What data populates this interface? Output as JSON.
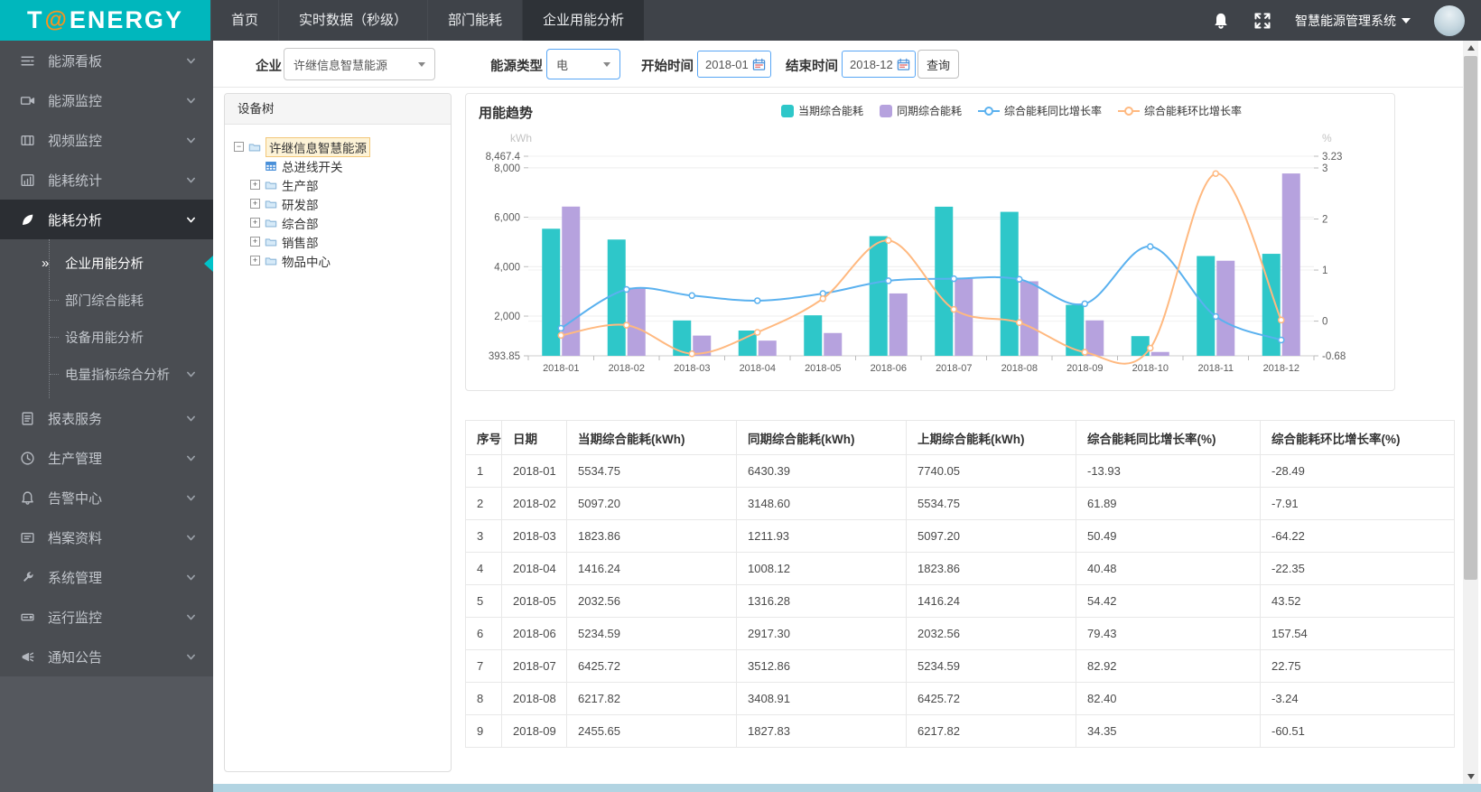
{
  "colors": {
    "brand_teal": "#00b7bd",
    "topbar_bg": "#3f4349",
    "sidebar_bg": "#4a4d52",
    "active_marker": "#00c2c9",
    "bar_current": "#2ec7c9",
    "bar_same_period": "#b6a2de",
    "line_yoy": "#5ab1ef",
    "line_mom": "#ffb980",
    "tree_highlight": "#fdf3d7"
  },
  "logo": {
    "t": "T",
    "at": "@",
    "rest": "ENERGY"
  },
  "topbar": {
    "nav": [
      {
        "label": "首页",
        "active": false
      },
      {
        "label": "实时数据（秒级）",
        "active": false
      },
      {
        "label": "部门能耗",
        "active": false
      },
      {
        "label": "企业用能分析",
        "active": true
      }
    ],
    "system_menu": "智慧能源管理系统"
  },
  "sidebar": {
    "items": [
      {
        "icon": "dashboard-icon",
        "label": "能源看板",
        "chevron": true
      },
      {
        "icon": "camera-icon",
        "label": "能源监控",
        "chevron": true
      },
      {
        "icon": "film-icon",
        "label": "视频监控",
        "chevron": true
      },
      {
        "icon": "stats-icon",
        "label": "能耗统计",
        "chevron": true
      },
      {
        "icon": "leaf-icon",
        "label": "能耗分析",
        "chevron": true,
        "active": true,
        "children": [
          {
            "label": "企业用能分析",
            "active": true
          },
          {
            "label": "部门综合能耗"
          },
          {
            "label": "设备用能分析"
          },
          {
            "label": "电量指标综合分析",
            "chevron": true
          }
        ]
      },
      {
        "icon": "report-icon",
        "label": "报表服务",
        "chevron": true
      },
      {
        "icon": "clock-icon",
        "label": "生产管理",
        "chevron": true
      },
      {
        "icon": "bell-icon",
        "label": "告警中心",
        "chevron": true
      },
      {
        "icon": "archive-icon",
        "label": "档案资料",
        "chevron": true
      },
      {
        "icon": "wrench-icon",
        "label": "系统管理",
        "chevron": true
      },
      {
        "icon": "drive-icon",
        "label": "运行监控",
        "chevron": true
      },
      {
        "icon": "megaphone-icon",
        "label": "通知公告",
        "chevron": true
      }
    ]
  },
  "filters": {
    "company_label": "企业",
    "company_value": "许继信息智慧能源",
    "energy_label": "能源类型",
    "energy_value": "电",
    "start_label": "开始时间",
    "start_value": "2018-01",
    "end_label": "结束时间",
    "end_value": "2018-12",
    "query_label": "查询"
  },
  "tree": {
    "title": "设备树",
    "root": {
      "label": "许继信息智慧能源",
      "selected": true
    },
    "children": [
      {
        "label": "总进线开关",
        "icon": "grid-icon",
        "expandable": false
      },
      {
        "label": "生产部",
        "icon": "folder-icon",
        "expandable": true
      },
      {
        "label": "研发部",
        "icon": "folder-icon",
        "expandable": true
      },
      {
        "label": "综合部",
        "icon": "folder-icon",
        "expandable": true
      },
      {
        "label": "销售部",
        "icon": "folder-icon",
        "expandable": true
      },
      {
        "label": "物品中心",
        "icon": "folder-icon",
        "expandable": true
      }
    ]
  },
  "chart": {
    "title": "用能趋势",
    "legend": [
      {
        "label": "当期综合能耗",
        "marker": "rect",
        "color": "#2ec7c9"
      },
      {
        "label": "同期综合能耗",
        "marker": "rect",
        "color": "#b6a2de"
      },
      {
        "label": "综合能耗同比增长率",
        "marker": "line",
        "color": "#5ab1ef"
      },
      {
        "label": "综合能耗环比增长率",
        "marker": "line",
        "color": "#ffb980"
      }
    ]
  },
  "chart_data": {
    "type": "bar",
    "title": "用能趋势",
    "categories": [
      "2018-01",
      "2018-02",
      "2018-03",
      "2018-04",
      "2018-05",
      "2018-06",
      "2018-07",
      "2018-08",
      "2018-09",
      "2018-10",
      "2018-11",
      "2018-12"
    ],
    "series": [
      {
        "name": "当期综合能耗",
        "type": "bar",
        "axis": "left",
        "color": "#2ec7c9",
        "values": [
          5534.75,
          5097.2,
          1823.86,
          1416.24,
          2032.56,
          5234.59,
          6425.72,
          6217.82,
          2455.65,
          1190,
          4430,
          4520
        ]
      },
      {
        "name": "同期综合能耗",
        "type": "bar",
        "axis": "left",
        "color": "#b6a2de",
        "values": [
          6430.39,
          3148.6,
          1211.93,
          1008.12,
          1316.28,
          2917.3,
          3512.86,
          3408.91,
          1827.83,
          550,
          4240,
          7770
        ]
      },
      {
        "name": "综合能耗同比增长率",
        "type": "line",
        "axis": "right",
        "color": "#5ab1ef",
        "values": [
          -0.14,
          0.62,
          0.5,
          0.4,
          0.54,
          0.79,
          0.83,
          0.82,
          0.34,
          1.46,
          0.09,
          -0.37
        ]
      },
      {
        "name": "综合能耗环比增长率",
        "type": "line",
        "axis": "right",
        "color": "#ffb980",
        "values": [
          -0.28,
          -0.08,
          -0.64,
          -0.22,
          0.44,
          1.58,
          0.23,
          -0.03,
          -0.61,
          -0.53,
          2.89,
          0.02
        ]
      }
    ],
    "y_left": {
      "name": "kWh",
      "min": 393.85,
      "max": 8467.4,
      "ticks": [
        393.85,
        2000,
        4000,
        6000,
        8000,
        8467.4
      ],
      "tick_labels": [
        "393.85",
        "2,000",
        "4,000",
        "6,000",
        "8,000",
        "8,467.4"
      ]
    },
    "y_right": {
      "name": "%",
      "min": -0.68,
      "max": 3.23,
      "ticks": [
        -0.68,
        0,
        1,
        2,
        3,
        3.23
      ],
      "tick_labels": [
        "-0.68",
        "0",
        "1",
        "2",
        "3",
        "3.23"
      ]
    },
    "grid": true,
    "legend_position": "top"
  },
  "table": {
    "headers": [
      "序号",
      "日期",
      "当期综合能耗(kWh)",
      "同期综合能耗(kWh)",
      "上期综合能耗(kWh)",
      "综合能耗同比增长率(%)",
      "综合能耗环比增长率(%)"
    ],
    "rows": [
      [
        "1",
        "2018-01",
        "5534.75",
        "6430.39",
        "7740.05",
        "-13.93",
        "-28.49"
      ],
      [
        "2",
        "2018-02",
        "5097.20",
        "3148.60",
        "5534.75",
        "61.89",
        "-7.91"
      ],
      [
        "3",
        "2018-03",
        "1823.86",
        "1211.93",
        "5097.20",
        "50.49",
        "-64.22"
      ],
      [
        "4",
        "2018-04",
        "1416.24",
        "1008.12",
        "1823.86",
        "40.48",
        "-22.35"
      ],
      [
        "5",
        "2018-05",
        "2032.56",
        "1316.28",
        "1416.24",
        "54.42",
        "43.52"
      ],
      [
        "6",
        "2018-06",
        "5234.59",
        "2917.30",
        "2032.56",
        "79.43",
        "157.54"
      ],
      [
        "7",
        "2018-07",
        "6425.72",
        "3512.86",
        "5234.59",
        "82.92",
        "22.75"
      ],
      [
        "8",
        "2018-08",
        "6217.82",
        "3408.91",
        "6425.72",
        "82.40",
        "-3.24"
      ],
      [
        "9",
        "2018-09",
        "2455.65",
        "1827.83",
        "6217.82",
        "34.35",
        "-60.51"
      ]
    ]
  }
}
